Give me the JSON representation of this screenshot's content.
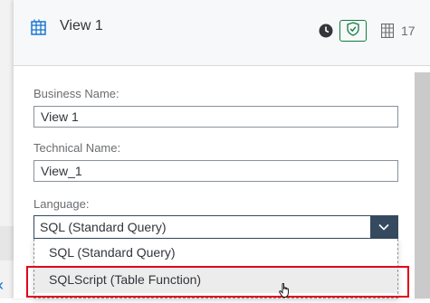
{
  "header": {
    "title": "View 1",
    "icon": "table-view-icon",
    "column_count": "17"
  },
  "form": {
    "business_name_label": "Business Name:",
    "business_name_value": "View 1",
    "technical_name_label": "Technical Name:",
    "technical_name_value": "View_1",
    "language_label": "Language:",
    "language_selected": "SQL (Standard Query)",
    "language_options": [
      "SQL (Standard Query)",
      "SQLScript (Table Function)"
    ]
  },
  "colors": {
    "accent": "#0a6ed1",
    "select_button": "#354a5f",
    "highlight_border": "#e2001a",
    "success": "#107e3e"
  }
}
